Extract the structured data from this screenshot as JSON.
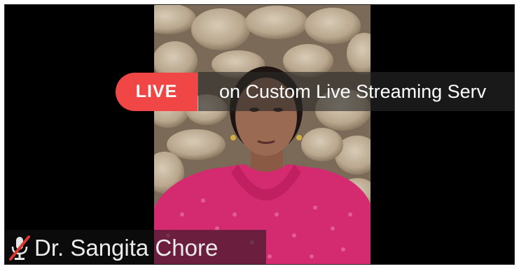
{
  "stream": {
    "live_label": "LIVE",
    "ticker_text": "on Custom Live Streaming Serv"
  },
  "participant": {
    "name": "Dr. Sangita Chore",
    "mic_status_icon": "mic-muted-icon"
  },
  "colors": {
    "live_badge": "#f04646",
    "background": "#000000",
    "ticker_bg": "#282828"
  }
}
